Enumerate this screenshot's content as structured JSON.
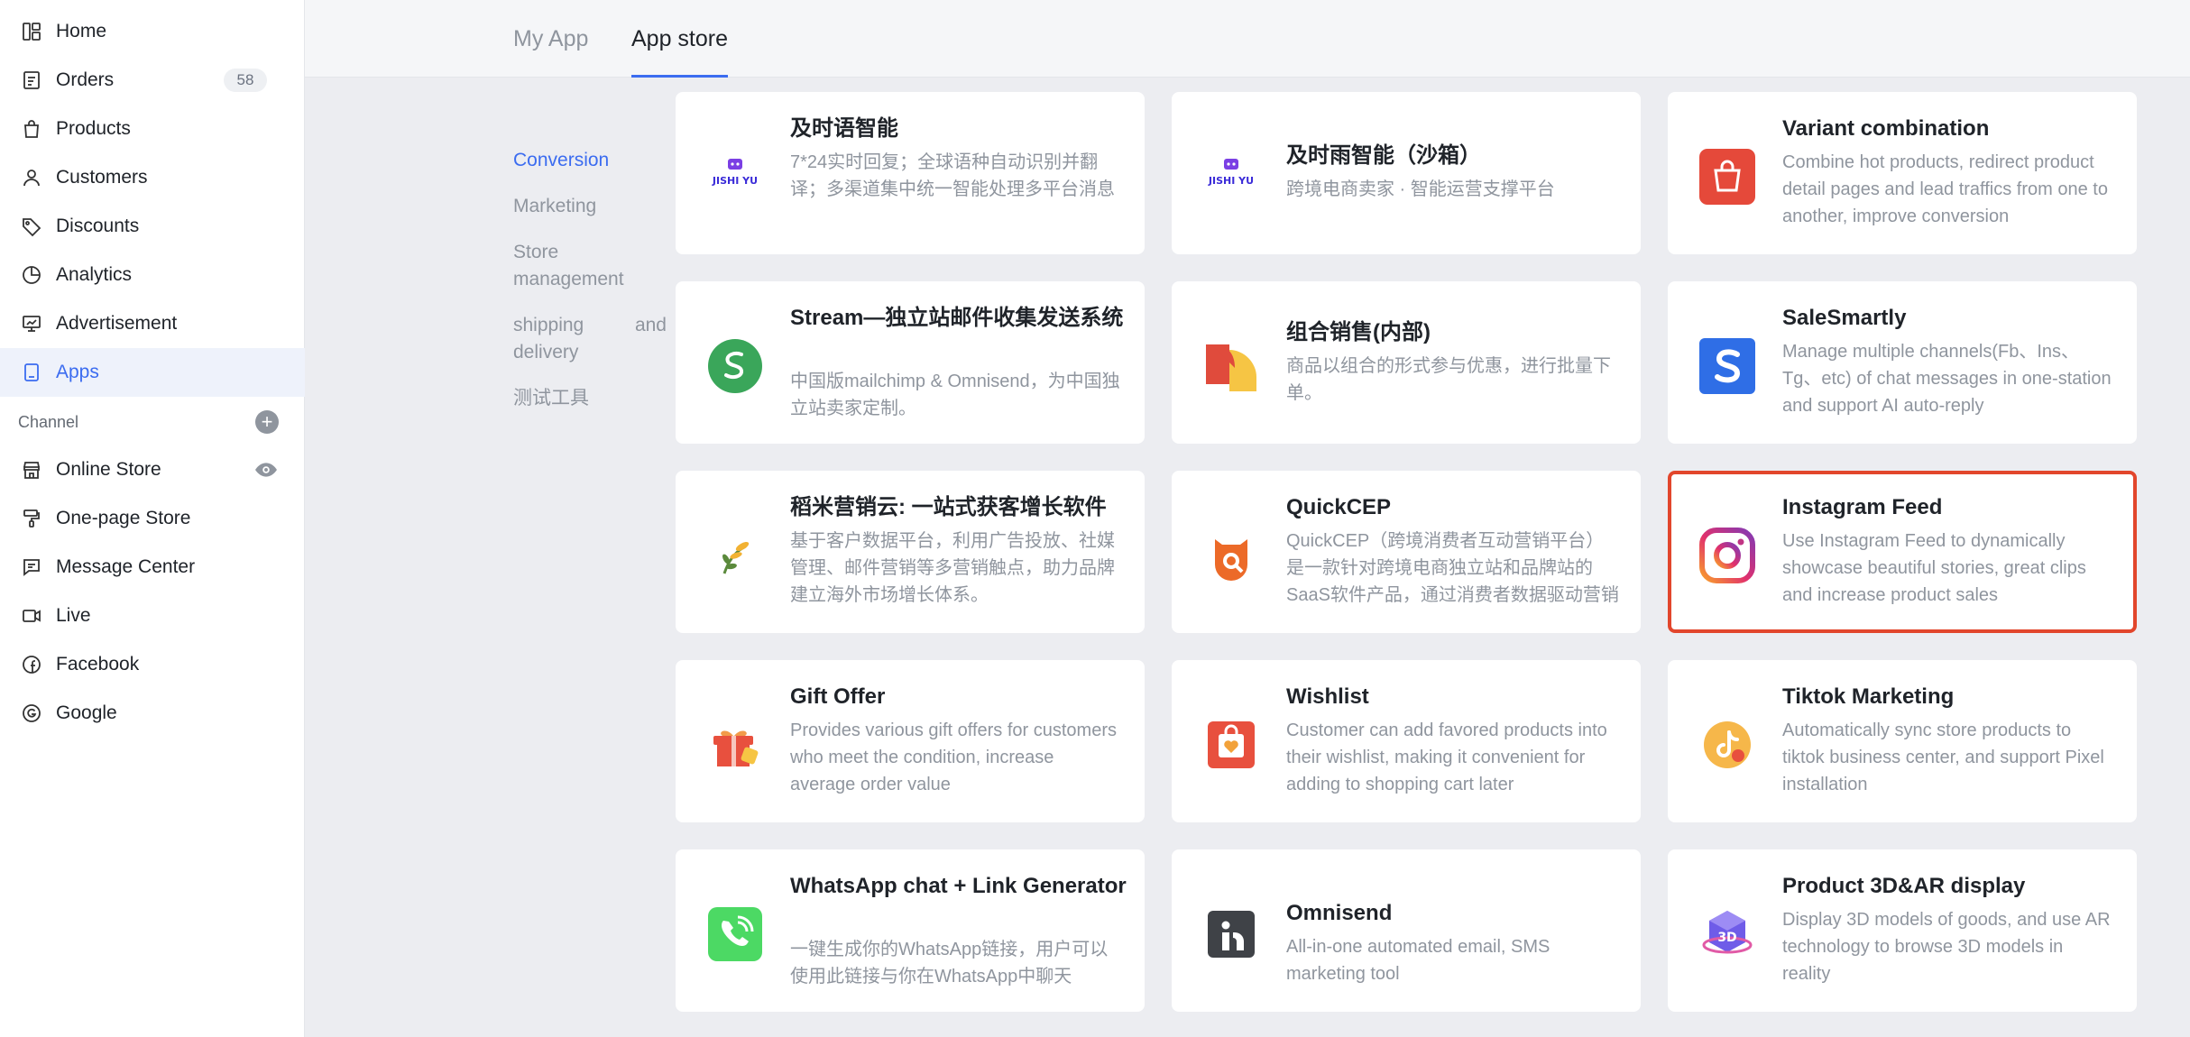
{
  "sidebar": {
    "items": [
      {
        "label": "Home",
        "icon": "dashboard-icon"
      },
      {
        "label": "Orders",
        "icon": "orders-icon",
        "badge": "58"
      },
      {
        "label": "Products",
        "icon": "bag-icon"
      },
      {
        "label": "Customers",
        "icon": "user-icon"
      },
      {
        "label": "Discounts",
        "icon": "tag-icon"
      },
      {
        "label": "Analytics",
        "icon": "pie-chart-icon"
      },
      {
        "label": "Advertisement",
        "icon": "monitor-chart-icon"
      },
      {
        "label": "Apps",
        "icon": "apps-icon",
        "active": true
      }
    ],
    "channel_label": "Channel",
    "channels": [
      {
        "label": "Online Store",
        "icon": "store-icon"
      },
      {
        "label": "One-page Store",
        "icon": "paint-roller-icon"
      },
      {
        "label": "Message Center",
        "icon": "message-icon"
      },
      {
        "label": "Live",
        "icon": "video-icon"
      },
      {
        "label": "Facebook",
        "icon": "facebook-icon"
      },
      {
        "label": "Google",
        "icon": "google-icon"
      }
    ]
  },
  "tabs": [
    {
      "label": "My App",
      "active": false
    },
    {
      "label": "App store",
      "active": true
    }
  ],
  "categories": [
    {
      "label": "Conversion",
      "active": true
    },
    {
      "label": "Marketing"
    },
    {
      "label": "Store management"
    },
    {
      "label": "shipping and delivery"
    },
    {
      "label": "测试工具"
    }
  ],
  "apps": [
    {
      "title": "及时语智能",
      "desc": "7*24实时回复；全球语种自动识别并翻译；多渠道集中统一智能处理多平台消息",
      "logo": "jishiyu-logo",
      "logo_text": "JISHI YU"
    },
    {
      "title": "及时雨智能（沙箱）",
      "desc": "跨境电商卖家 · 智能运营支撑平台",
      "logo": "jishiyu-logo",
      "logo_text": "JISHI YU"
    },
    {
      "title": "Variant combination",
      "desc": "Combine hot products, redirect product detail pages and lead traffics from one to another, improve conversion",
      "logo": "shopping-bag-logo"
    },
    {
      "title": "Stream—独立站邮件收集发送系统",
      "desc": "中国版mailchimp & Omnisend，为中国独立站卖家定制。",
      "logo": "stream-logo"
    },
    {
      "title": "组合销售(内部)",
      "desc": "商品以组合的形式参与优惠，进行批量下单。",
      "logo": "bundle-logo"
    },
    {
      "title": "SaleSmartly",
      "desc": "Manage multiple channels(Fb、Ins、Tg、etc) of chat messages in one-station and support AI auto-reply",
      "logo": "salesmartly-logo"
    },
    {
      "title": "稻米营销云: 一站式获客增长软件",
      "desc": "基于客户数据平台，利用广告投放、社媒管理、邮件营销等多营销触点，助力品牌建立海外市场增长体系。",
      "logo": "rice-logo"
    },
    {
      "title": "QuickCEP",
      "desc": "QuickCEP（跨境消费者互动营销平台）是一款针对跨境电商独立站和品牌站的SaaS软件产品，通过消费者数据驱动营销",
      "logo": "quickcep-logo"
    },
    {
      "title": "Instagram Feed",
      "desc": "Use Instagram Feed to dynamically showcase beautiful stories, great clips and increase product sales",
      "logo": "instagram-logo",
      "highlighted": true
    },
    {
      "title": "Gift Offer",
      "desc": "Provides various gift offers for customers who meet the condition, increase average order value",
      "logo": "gift-logo"
    },
    {
      "title": "Wishlist",
      "desc": "Customer can add favored products into their wishlist, making it convenient for adding to shopping cart later",
      "logo": "wishlist-logo"
    },
    {
      "title": "Tiktok Marketing",
      "desc": "Automatically sync store products to tiktok business center, and support Pixel installation",
      "logo": "tiktok-logo"
    },
    {
      "title": "WhatsApp chat + Link Generator",
      "desc": "一键生成你的WhatsApp链接，用户可以使用此链接与你在WhatsApp中聊天",
      "logo": "whatsapp-logo"
    },
    {
      "title": "Omnisend",
      "desc": "All-in-one automated email, SMS marketing tool",
      "logo": "omnisend-logo"
    },
    {
      "title": "Product 3D&AR display",
      "desc": "Display 3D models of goods, and use AR technology to browse 3D models in reality",
      "logo": "cube-3d-logo",
      "logo_text": "3D"
    }
  ],
  "colors": {
    "accent": "#3b6cf0",
    "highlight": "#e2462c"
  }
}
